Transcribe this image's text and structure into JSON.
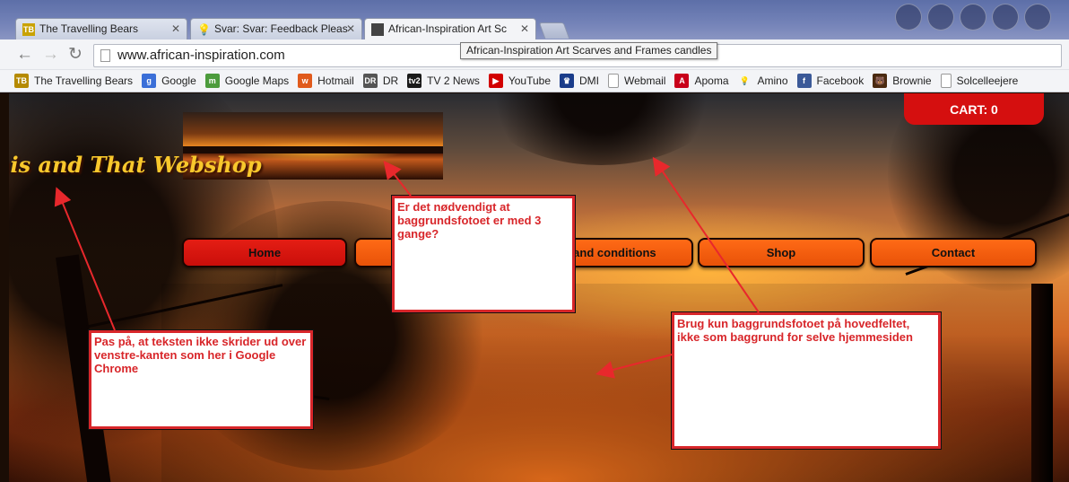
{
  "browser": {
    "tabs": [
      {
        "label": "The Travelling Bears",
        "favicon": "TB",
        "active": false
      },
      {
        "label": "Svar: Svar: Feedback Pleas",
        "favicon": "bulb-icon",
        "active": false
      },
      {
        "label": "African-Inspiration Art Sc",
        "favicon": "image-icon",
        "active": true
      }
    ],
    "tooltip": "African-Inspiration Art Scarves and Frames candles",
    "url": "www.african-inspiration.com",
    "bookmarks": [
      {
        "label": "The Travelling Bears",
        "icon": "TB",
        "color": "#b58a00"
      },
      {
        "label": "Google",
        "icon": "g",
        "color": "#3b6fd8"
      },
      {
        "label": "Google Maps",
        "icon": "m",
        "color": "#4c9b3c"
      },
      {
        "label": "Hotmail",
        "icon": "w",
        "color": "#e05a1c"
      },
      {
        "label": "DR",
        "icon": "DR",
        "color": "#555555"
      },
      {
        "label": "TV 2 News",
        "icon": "tv2",
        "color": "#1a1a1a"
      },
      {
        "label": "YouTube",
        "icon": "▶",
        "color": "#d20000"
      },
      {
        "label": "DMI",
        "icon": "♛",
        "color": "#1a3c8a"
      },
      {
        "label": "Webmail",
        "icon": "",
        "color": "#ffffff"
      },
      {
        "label": "Apoma",
        "icon": "A",
        "color": "#c8001a"
      },
      {
        "label": "Amino",
        "icon": "💡",
        "color": "#f3f4f7"
      },
      {
        "label": "Facebook",
        "icon": "f",
        "color": "#3b5998"
      },
      {
        "label": "Brownie",
        "icon": "🐻",
        "color": "#4a2a10"
      },
      {
        "label": "Solcelleejere",
        "icon": "",
        "color": "#ffffff"
      }
    ]
  },
  "site": {
    "title": "his and That Webshop",
    "cart": "CART: 0",
    "menu": [
      "Home",
      "",
      "s and conditions",
      "Shop",
      "Contact"
    ]
  },
  "annotations": {
    "photo_note": "Er det nødvendigt at baggrundsfotoet er med 3 gange?",
    "text_note": "Pas på, at teksten ikke skrider ud over venstre-kanten som her i Google Chrome",
    "bg_note": "Brug kun baggrundsfotoet på hovedfeltet, ikke som baggrund for selve hjemmesiden"
  },
  "colors": {
    "annotation": "#d8262a",
    "cart": "#d50f0f",
    "menu": "#ff6a16",
    "title": "#f8c82c"
  }
}
